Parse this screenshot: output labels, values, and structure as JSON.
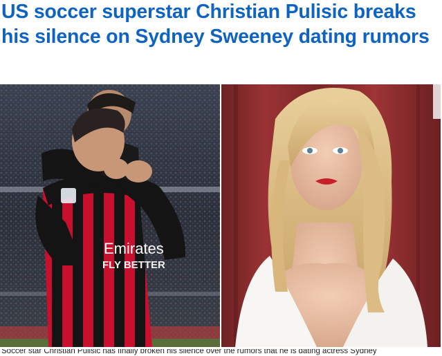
{
  "article": {
    "headline": "US soccer superstar Christian Pulisic breaks his silence on Sydney Sweeney dating rumors",
    "caption": "Soccer star Christian Pulisic has finally broken his silence over the rumors that he is dating actress Sydney",
    "images": [
      {
        "id": "left",
        "subject": "soccer-player-heart-gesture-photo",
        "jersey_text": "Emirates FLY BETTER"
      },
      {
        "id": "right",
        "subject": "actress-portrait-photo"
      }
    ]
  },
  "colors": {
    "headline": "#0e63c3",
    "jersey_red": "#c8102e",
    "jersey_black": "#141414",
    "backdrop_red": "#8a2a2c"
  }
}
